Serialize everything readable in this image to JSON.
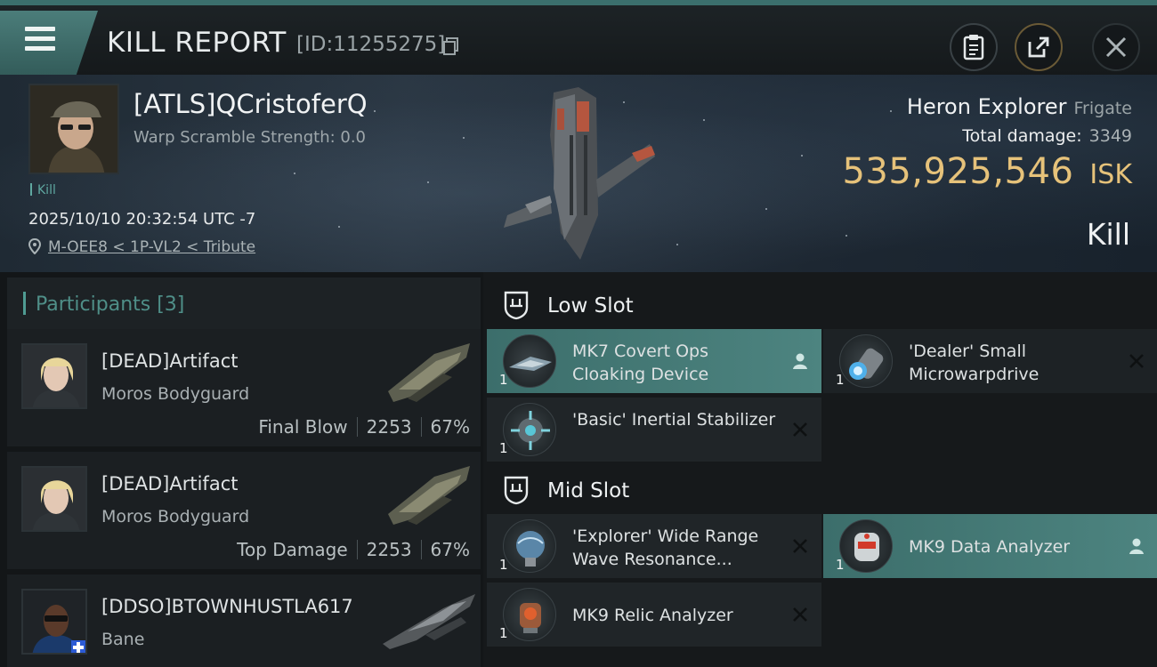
{
  "header": {
    "title": "KILL REPORT",
    "report_id": "[ID:11255275]"
  },
  "victim": {
    "name": "[ATLS]QCristoferQ",
    "warp_scramble": "Warp Scramble Strength: 0.0",
    "tag": "Kill",
    "datetime": "2025/10/10 20:32:54 UTC -7",
    "location": "M-OEE8 < 1P-VL2 < Tribute",
    "ship_name": "Heron Explorer",
    "ship_class": "Frigate",
    "total_damage_label": "Total damage:",
    "total_damage": "3349",
    "isk_value": "535,925,546",
    "isk_unit": "ISK",
    "result": "Kill"
  },
  "participants": {
    "header": "Participants [3]",
    "items": [
      {
        "name": "[DEAD]Artifact",
        "ship": "Moros Bodyguard",
        "role": "Final Blow",
        "damage": "2253",
        "percent": "67%"
      },
      {
        "name": "[DEAD]Artifact",
        "ship": "Moros Bodyguard",
        "role": "Top Damage",
        "damage": "2253",
        "percent": "67%"
      },
      {
        "name": "[DDSO]BTOWNHUSTLA617",
        "ship": "Bane"
      }
    ]
  },
  "slots": {
    "low": {
      "title": "Low Slot",
      "modules": [
        {
          "name": "MK7 Covert Ops Cloaking Device",
          "qty": "1",
          "state": "fitted"
        },
        {
          "name": "'Dealer' Small Microwarpdrive",
          "qty": "1",
          "state": "destroyed"
        },
        {
          "name": "'Basic' Inertial Stabilizer",
          "qty": "1",
          "state": "destroyed"
        }
      ]
    },
    "mid": {
      "title": "Mid Slot",
      "modules": [
        {
          "name": "'Explorer' Wide Range Wave Resonance...",
          "qty": "1",
          "state": "destroyed"
        },
        {
          "name": "MK9 Data Analyzer",
          "qty": "1",
          "state": "fitted"
        },
        {
          "name": "MK9 Relic Analyzer",
          "qty": "1",
          "state": "destroyed"
        }
      ]
    }
  },
  "colors": {
    "accent": "#4d8480",
    "isk_gold": "#e6c27a",
    "teal_text": "#4f8f88"
  },
  "icons": [
    "menu-icon",
    "copy-icon",
    "report-icon",
    "share-icon",
    "close-icon",
    "location-pin-icon",
    "slot-shield-icon",
    "pilot-icon",
    "destroyed-x-icon"
  ]
}
